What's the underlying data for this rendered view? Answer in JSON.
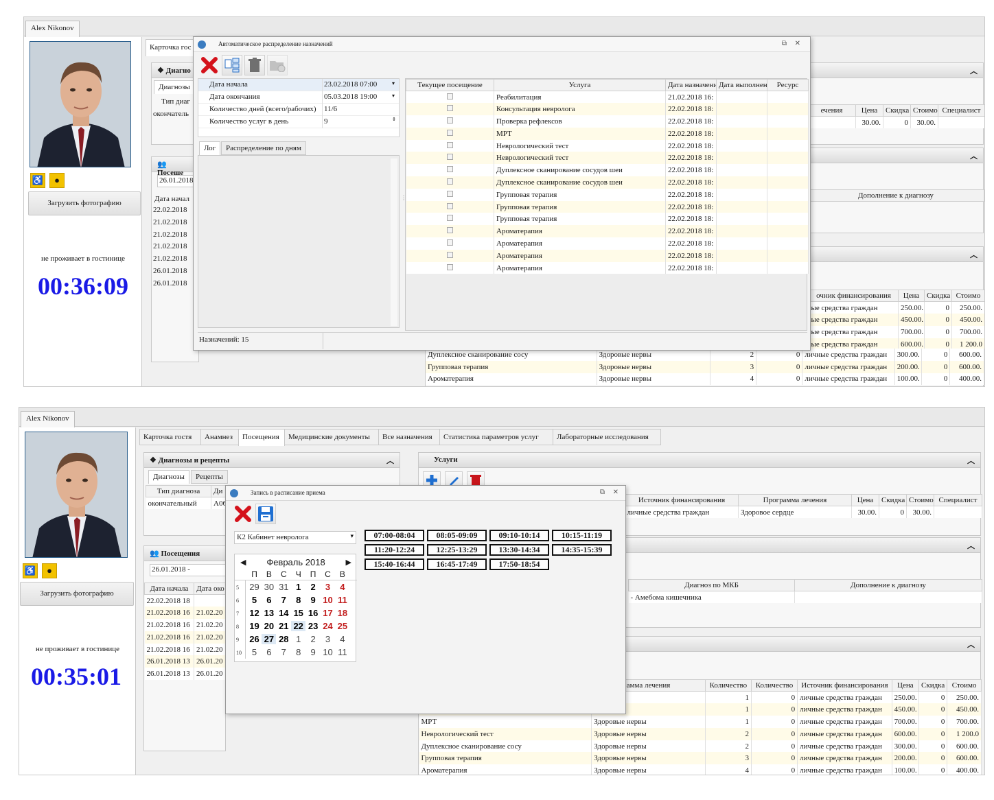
{
  "top": {
    "user_tab": "Alex Nikonov",
    "main_tab_partial": "Карточка гос",
    "diag_section": "Диагно",
    "diag_subtab": "Диагнозы",
    "diag_col": "Тип диаг",
    "diag_val": "окончатель",
    "visits_section": "Посеще",
    "visit_date": "26.01.2018",
    "visits_col": "Дата начал",
    "visits_rows": [
      "22.02.2018",
      "21.02.2018",
      "21.02.2018",
      "21.02.2018",
      "21.02.2018",
      "26.01.2018",
      "26.01.2018"
    ],
    "load_photo": "Загрузить фотографию",
    "hotel_status": "не проживает в гостинице",
    "timer": "00:36:09",
    "dialog": {
      "title": "Автоматическое распределение назначений",
      "props": [
        {
          "name": "Дата начала",
          "value": "23.02.2018 07:00"
        },
        {
          "name": "Дата окончания",
          "value": "05.03.2018 19:00"
        },
        {
          "name": "Количество дней (всего/рабочих)",
          "value": "11/6"
        },
        {
          "name": "Количество услуг в день",
          "value": "9"
        }
      ],
      "tabs": [
        "Лог",
        "Распределение по дням"
      ],
      "footer": "Назначений: 15",
      "table_headers": [
        "Текущее посещение",
        "Услуга",
        "Дата назначения",
        "Дата выполнения",
        "Ресурс"
      ],
      "rows": [
        {
          "service": "Реабилитация",
          "date": "21.02.2018 16:"
        },
        {
          "service": "Консультация невролога",
          "date": "22.02.2018 18:"
        },
        {
          "service": "Проверка рефлексов",
          "date": "22.02.2018 18:"
        },
        {
          "service": "МРТ",
          "date": "22.02.2018 18:"
        },
        {
          "service": "Неврологический тест",
          "date": "22.02.2018 18:"
        },
        {
          "service": "Неврологический тест",
          "date": "22.02.2018 18:"
        },
        {
          "service": "Дуплексное сканирование сосудов шеи",
          "date": "22.02.2018 18:"
        },
        {
          "service": "Дуплексное сканирование сосудов шеи",
          "date": "22.02.2018 18:"
        },
        {
          "service": "Групповая терапия",
          "date": "22.02.2018 18:"
        },
        {
          "service": "Групповая терапия",
          "date": "22.02.2018 18:"
        },
        {
          "service": "Групповая терапия",
          "date": "22.02.2018 18:"
        },
        {
          "service": "Ароматерапия",
          "date": "22.02.2018 18:"
        },
        {
          "service": "Ароматерапия",
          "date": "22.02.2018 18:"
        },
        {
          "service": "Ароматерапия",
          "date": "22.02.2018 18:"
        },
        {
          "service": "Ароматерапия",
          "date": "22.02.2018 18:"
        }
      ]
    },
    "right": {
      "services_headers": [
        "ечения",
        "Цена",
        "Скидка",
        "Стоимо",
        "Специалист"
      ],
      "services_row": [
        "",
        "30.00.",
        "0",
        "30.00.",
        ""
      ],
      "diag_header": "Дополнение к диагнозу",
      "appt_headers": [
        "очник финансирования",
        "Цена",
        "Скидка",
        "Стоимо"
      ],
      "appt_rows": [
        [
          "ые средства граждан",
          "250.00.",
          "0",
          "250.00."
        ],
        [
          "ые средства граждан",
          "450.00.",
          "0",
          "450.00."
        ],
        [
          "ые средства граждан",
          "700.00.",
          "0",
          "700.00."
        ],
        [
          "ые средства граждан",
          "600.00.",
          "0",
          "1 200.0"
        ]
      ],
      "bottom_rows": [
        [
          "Дуплексное сканирование сосу",
          "Здоровые нервы",
          "2",
          "0",
          "личные средства граждан",
          "300.00.",
          "0",
          "600.00."
        ],
        [
          "Групповая терапия",
          "Здоровые нервы",
          "3",
          "0",
          "личные средства граждан",
          "200.00.",
          "0",
          "600.00."
        ],
        [
          "Ароматерапия",
          "Здоровые нервы",
          "4",
          "0",
          "личные средства граждан",
          "100.00.",
          "0",
          "400.00."
        ]
      ]
    }
  },
  "bottom": {
    "user_tab": "Alex Nikonov",
    "main_tabs": [
      "Карточка гостя",
      "Анамнез",
      "Посещения",
      "Медицинские документы",
      "Все назначения",
      "Статистика параметров услуг",
      "Лабораторные исследования"
    ],
    "diag_section": "Диагнозы и рецепты",
    "diag_subtabs": [
      "Диагнозы",
      "Рецепты"
    ],
    "diag_cols": [
      "Тип диагноза",
      "Ди"
    ],
    "diag_row": [
      "окончательный",
      "А06"
    ],
    "visits_section": "Посещения",
    "visit_date": "26.01.2018 -",
    "visits_cols": [
      "Дата начала",
      "Дата око"
    ],
    "visits_rows": [
      [
        "22.02.2018 18",
        ""
      ],
      [
        "21.02.2018 16",
        "21.02.20"
      ],
      [
        "21.02.2018 16",
        "21.02.20"
      ],
      [
        "21.02.2018 16",
        "21.02.20"
      ],
      [
        "21.02.2018 16",
        "21.02.20"
      ],
      [
        "26.01.2018 13",
        "26.01.20"
      ],
      [
        "26.01.2018 13",
        "26.01.20"
      ]
    ],
    "load_photo": "Загрузить фотографию",
    "hotel_status": "не проживает в гостинице",
    "timer": "00:35:01",
    "services_section": "Услуги",
    "services_headers": [
      "Источник финансирования",
      "Программа лечения",
      "Цена",
      "Скидка",
      "Стоимо",
      "Специалист"
    ],
    "services_row": [
      "личные средства граждан",
      "Здоровое сердце",
      "30.00.",
      "0",
      "30.00.",
      ""
    ],
    "mkb_headers": [
      "Диагноз по МКБ",
      "Дополнение к диагнозу"
    ],
    "mkb_row": [
      "- Амебома кишечника",
      ""
    ],
    "appt_headers": [
      "",
      "амма лечения",
      "Количество",
      "Количество",
      "Источник финансирования",
      "Цена",
      "Скидка",
      "Стоимо"
    ],
    "appt_rows": [
      [
        "",
        "рвы",
        "1",
        "0",
        "личные средства граждан",
        "250.00.",
        "0",
        "250.00."
      ],
      [
        "",
        "рвы",
        "1",
        "0",
        "личные средства граждан",
        "450.00.",
        "0",
        "450.00."
      ],
      [
        "МРТ",
        "Здоровые нервы",
        "1",
        "0",
        "личные средства граждан",
        "700.00.",
        "0",
        "700.00."
      ],
      [
        "Неврологический тест",
        "Здоровые нервы",
        "2",
        "0",
        "личные средства граждан",
        "600.00.",
        "0",
        "1 200.0"
      ],
      [
        "Дуплексное сканирование сосу",
        "Здоровые нервы",
        "2",
        "0",
        "личные средства граждан",
        "300.00.",
        "0",
        "600.00."
      ],
      [
        "Групповая терапия",
        "Здоровые нервы",
        "3",
        "0",
        "личные средства граждан",
        "200.00.",
        "0",
        "600.00."
      ],
      [
        "Ароматерапия",
        "Здоровые нервы",
        "4",
        "0",
        "личные средства граждан",
        "100.00.",
        "0",
        "400.00."
      ]
    ],
    "dialog": {
      "title": "Запись в расписание приема",
      "cabinet": "К2 Кабинет невролога",
      "slots": [
        "07:00-08:04",
        "08:05-09:09",
        "09:10-10:14",
        "10:15-11:19",
        "11:20-12:24",
        "12:25-13:29",
        "13:30-14:34",
        "14:35-15:39",
        "15:40-16:44",
        "16:45-17:49",
        "17:50-18:54"
      ],
      "calendar": {
        "month": "Февраль 2018",
        "weekdays": [
          "П",
          "В",
          "С",
          "Ч",
          "П",
          "С",
          "В"
        ],
        "weeks": [
          {
            "num": "5",
            "days": [
              "29",
              "30",
              "31",
              "1",
              "2",
              "3",
              "4"
            ]
          },
          {
            "num": "6",
            "days": [
              "5",
              "6",
              "7",
              "8",
              "9",
              "10",
              "11"
            ]
          },
          {
            "num": "7",
            "days": [
              "12",
              "13",
              "14",
              "15",
              "16",
              "17",
              "18"
            ]
          },
          {
            "num": "8",
            "days": [
              "19",
              "20",
              "21",
              "22",
              "23",
              "24",
              "25"
            ]
          },
          {
            "num": "9",
            "days": [
              "26",
              "27",
              "28",
              "1",
              "2",
              "3",
              "4"
            ]
          },
          {
            "num": "10",
            "days": [
              "5",
              "6",
              "7",
              "8",
              "9",
              "10",
              "11"
            ]
          }
        ]
      }
    }
  }
}
